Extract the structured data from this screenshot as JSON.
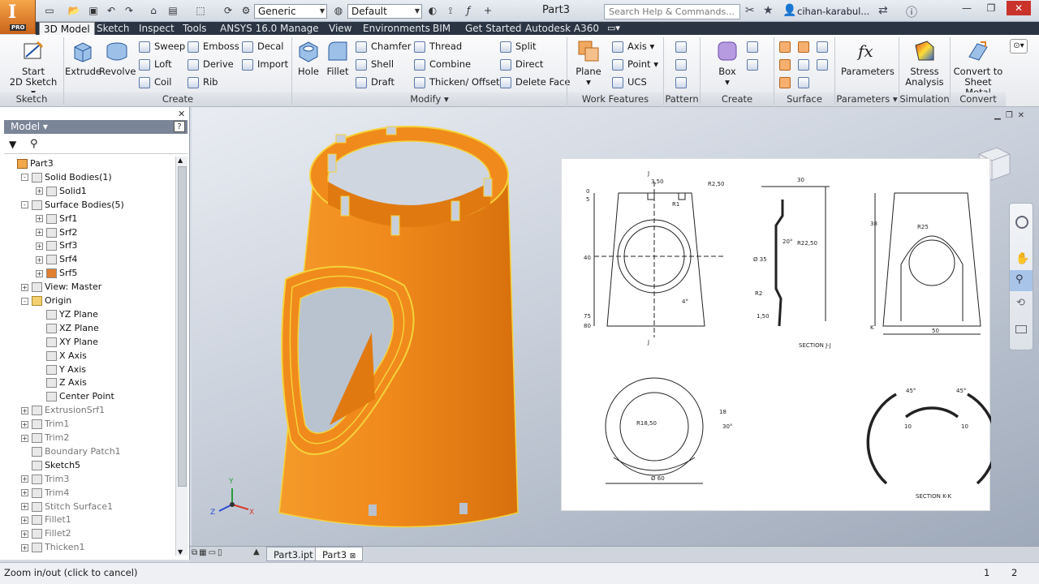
{
  "app": {
    "product_letter": "I",
    "edition": "PRO"
  },
  "quick_access": {
    "appearance_value": "Generic",
    "style_value": "Default"
  },
  "title": {
    "document": "Part3",
    "search_placeholder": "Search Help & Commands...",
    "user": "cihan-karabul..."
  },
  "tabs": [
    "3D Model",
    "Sketch",
    "Inspect",
    "Tools",
    "ANSYS 16.0",
    "Manage",
    "View",
    "Environments",
    "BIM",
    "Get Started",
    "Autodesk A360"
  ],
  "ribbon": {
    "sketch": {
      "start": "Start",
      "start2": "2D Sketch",
      "title": "Sketch"
    },
    "create": {
      "extrude": "Extrude",
      "revolve": "Revolve",
      "sweep": "Sweep",
      "loft": "Loft",
      "coil": "Coil",
      "emboss": "Emboss",
      "derive": "Derive",
      "rib": "Rib",
      "decal": "Decal",
      "import": "Import",
      "title": "Create"
    },
    "modify": {
      "hole": "Hole",
      "fillet": "Fillet",
      "chamfer": "Chamfer",
      "shell": "Shell",
      "draft": "Draft",
      "thread": "Thread",
      "combine": "Combine",
      "thicken": "Thicken/ Offset",
      "split": "Split",
      "direct": "Direct",
      "delete_face": "Delete Face",
      "title": "Modify"
    },
    "work": {
      "plane": "Plane",
      "axis": "Axis",
      "point": "Point",
      "ucs": "UCS",
      "title": "Work Features"
    },
    "pattern": {
      "title": "Pattern"
    },
    "freeform": {
      "box": "Box",
      "title": "Create Freeform"
    },
    "surface": {
      "title": "Surface"
    },
    "parameters": {
      "label": "Parameters",
      "title": "Parameters"
    },
    "simulation": {
      "stress": "Stress",
      "analysis": "Analysis",
      "title": "Simulation"
    },
    "convert": {
      "l1": "Convert to",
      "l2": "Sheet Metal",
      "title": "Convert"
    }
  },
  "browser": {
    "title": "Model",
    "help": "?",
    "tree": [
      {
        "label": "Part3",
        "depth": 0,
        "exp": "",
        "dim": false
      },
      {
        "label": "Solid Bodies(1)",
        "depth": 1,
        "exp": "-",
        "dim": false
      },
      {
        "label": "Solid1",
        "depth": 2,
        "exp": "+",
        "dim": false
      },
      {
        "label": "Surface Bodies(5)",
        "depth": 1,
        "exp": "-",
        "dim": false
      },
      {
        "label": "Srf1",
        "depth": 2,
        "exp": "+",
        "dim": false
      },
      {
        "label": "Srf2",
        "depth": 2,
        "exp": "+",
        "dim": false
      },
      {
        "label": "Srf3",
        "depth": 2,
        "exp": "+",
        "dim": false
      },
      {
        "label": "Srf4",
        "depth": 2,
        "exp": "+",
        "dim": false
      },
      {
        "label": "Srf5",
        "depth": 2,
        "exp": "+",
        "dim": false
      },
      {
        "label": "View: Master",
        "depth": 1,
        "exp": "+",
        "dim": false
      },
      {
        "label": "Origin",
        "depth": 1,
        "exp": "-",
        "dim": false
      },
      {
        "label": "YZ Plane",
        "depth": 2,
        "exp": "",
        "dim": false
      },
      {
        "label": "XZ Plane",
        "depth": 2,
        "exp": "",
        "dim": false
      },
      {
        "label": "XY Plane",
        "depth": 2,
        "exp": "",
        "dim": false
      },
      {
        "label": "X Axis",
        "depth": 2,
        "exp": "",
        "dim": false
      },
      {
        "label": "Y Axis",
        "depth": 2,
        "exp": "",
        "dim": false
      },
      {
        "label": "Z Axis",
        "depth": 2,
        "exp": "",
        "dim": false
      },
      {
        "label": "Center Point",
        "depth": 2,
        "exp": "",
        "dim": false
      },
      {
        "label": "ExtrusionSrf1",
        "depth": 1,
        "exp": "+",
        "dim": true
      },
      {
        "label": "Trim1",
        "depth": 1,
        "exp": "+",
        "dim": true
      },
      {
        "label": "Trim2",
        "depth": 1,
        "exp": "+",
        "dim": true
      },
      {
        "label": "Boundary Patch1",
        "depth": 1,
        "exp": "",
        "dim": true
      },
      {
        "label": "Sketch5",
        "depth": 1,
        "exp": "",
        "dim": false
      },
      {
        "label": "Trim3",
        "depth": 1,
        "exp": "+",
        "dim": true
      },
      {
        "label": "Trim4",
        "depth": 1,
        "exp": "+",
        "dim": true
      },
      {
        "label": "Stitch Surface1",
        "depth": 1,
        "exp": "+",
        "dim": true
      },
      {
        "label": "Fillet1",
        "depth": 1,
        "exp": "+",
        "dim": true
      },
      {
        "label": "Fillet2",
        "depth": 1,
        "exp": "+",
        "dim": true
      },
      {
        "label": "Thicken1",
        "depth": 1,
        "exp": "+",
        "dim": true
      }
    ]
  },
  "drawing": {
    "dims": [
      "3,50",
      "R2,50",
      "R1",
      "0",
      "5",
      "40",
      "75",
      "80",
      "4°",
      "30",
      "20°",
      "R22,50",
      "Ø 35",
      "R2",
      "1,50",
      "SECTION J-J",
      "38",
      "R25",
      "50",
      "R18,50",
      "18",
      "30°",
      "Ø 60",
      "45°",
      "45°",
      "10",
      "10",
      "SECTION K-K",
      "J",
      "J",
      "K"
    ]
  },
  "axes": {
    "x": "X",
    "y": "Y",
    "z": "Z"
  },
  "doc_tabs": [
    "Part3.ipt",
    "Part3"
  ],
  "status": {
    "message": "Zoom in/out (click to cancel)",
    "n1": "1",
    "n2": "2"
  },
  "colors": {
    "part": "#f08a1c",
    "highlight": "#f5d33a",
    "ribbon_tab_bg": "#2a3442"
  }
}
